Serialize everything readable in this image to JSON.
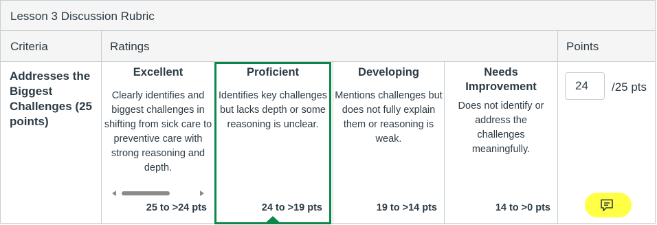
{
  "rubric": {
    "title": "Lesson 3 Discussion Rubric",
    "headers": {
      "criteria": "Criteria",
      "ratings": "Ratings",
      "points": "Points"
    },
    "criterion": {
      "description": "Addresses the Biggest Challenges (25 points)"
    },
    "ratings": [
      {
        "title": "Excellent",
        "description": "Clearly identifies and biggest challenges in shifting from sick care to preventive care with strong reasoning and depth.",
        "points": "25 to >24 pts",
        "selected": false
      },
      {
        "title": "Proficient",
        "description": "Identifies key challenges but lacks depth or some reasoning is unclear.",
        "points": "24 to >19 pts",
        "selected": true
      },
      {
        "title": "Developing",
        "description": "Mentions challenges but does not fully explain them or reasoning is weak.",
        "points": "19 to >14 pts",
        "selected": false
      },
      {
        "title": "Needs Improvement",
        "description": "Does not identify or address the challenges meaningfully.",
        "points": "14 to >0 pts",
        "selected": false
      }
    ],
    "points": {
      "value": "24",
      "total": "/25 pts"
    }
  },
  "colors": {
    "selected_border": "#0b874b",
    "highlight": "#ffff3c",
    "text": "#2d3b45",
    "border": "#c7cdd1",
    "header_bg": "#f5f5f5"
  },
  "icons": {
    "comment": "comment-icon"
  }
}
